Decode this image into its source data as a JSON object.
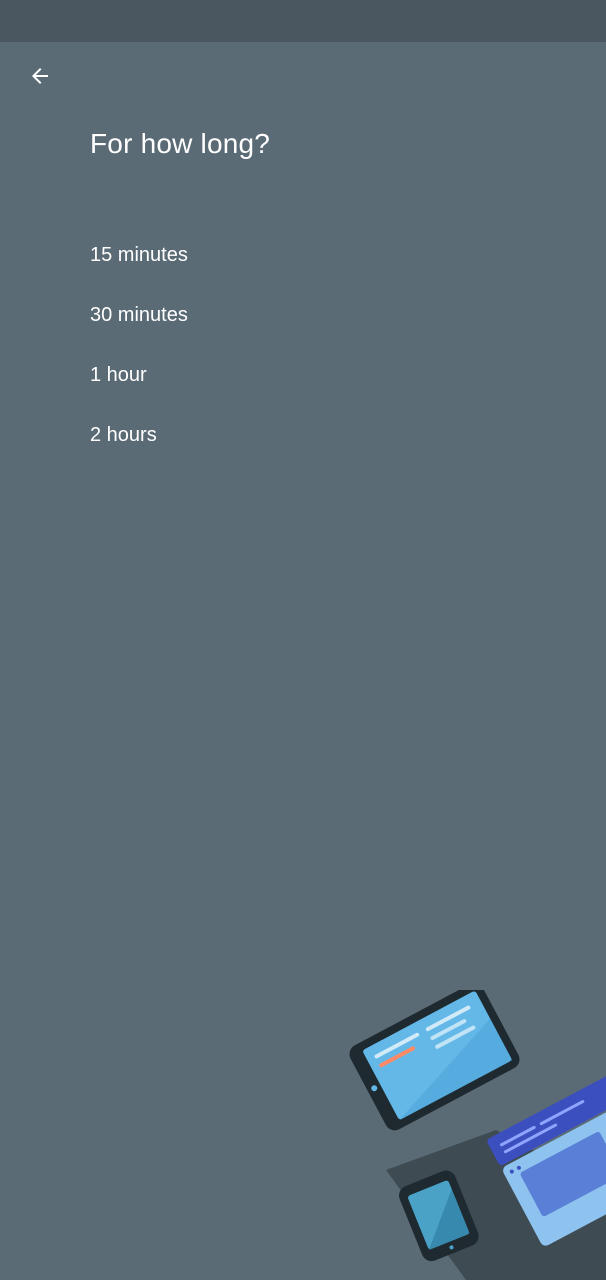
{
  "header": {
    "back_icon": "arrow-left-icon",
    "title": "For how long?"
  },
  "options": [
    {
      "label": "15 minutes"
    },
    {
      "label": "30 minutes"
    },
    {
      "label": "1 hour"
    },
    {
      "label": "2 hours"
    }
  ],
  "colors": {
    "background": "#5b6b76",
    "status_bar": "#4a5761",
    "text": "#ffffff"
  },
  "illustration": {
    "icons": [
      "tablet-icon",
      "phone-icon",
      "laptop-icon"
    ]
  }
}
